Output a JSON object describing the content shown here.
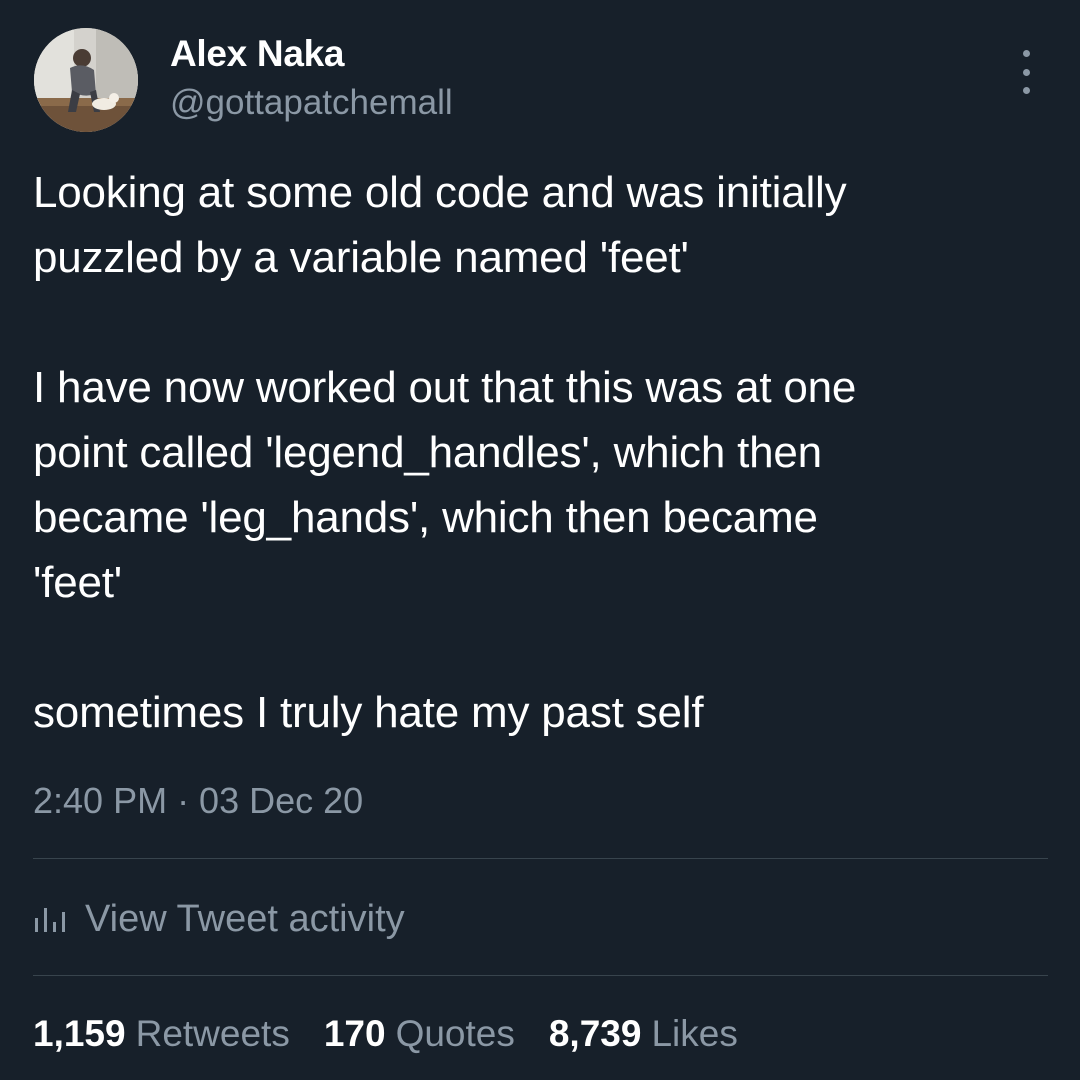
{
  "author": {
    "display_name": "Alex Naka",
    "handle": "@gottapatchemall",
    "avatar_icon": "profile-photo"
  },
  "tweet": {
    "paragraphs": [
      "Looking at some old code and was initially\npuzzled by a variable named 'feet'",
      "I have now worked out that this was at one\npoint called 'legend_handles', which then\nbecame 'leg_hands', which then became\n'feet'",
      "sometimes I truly hate my past self"
    ],
    "timestamp": "2:40 PM · 03 Dec 20"
  },
  "activity": {
    "label": "View Tweet activity",
    "icon": "bar-chart-icon"
  },
  "stats": {
    "retweets": {
      "count": "1,159",
      "label": "Retweets"
    },
    "quotes": {
      "count": "170",
      "label": "Quotes"
    },
    "likes": {
      "count": "8,739",
      "label": "Likes"
    }
  },
  "colors": {
    "background": "#17202a",
    "primary_text": "#ffffff",
    "secondary_text": "#8b98a5",
    "divider": "#38444d"
  }
}
